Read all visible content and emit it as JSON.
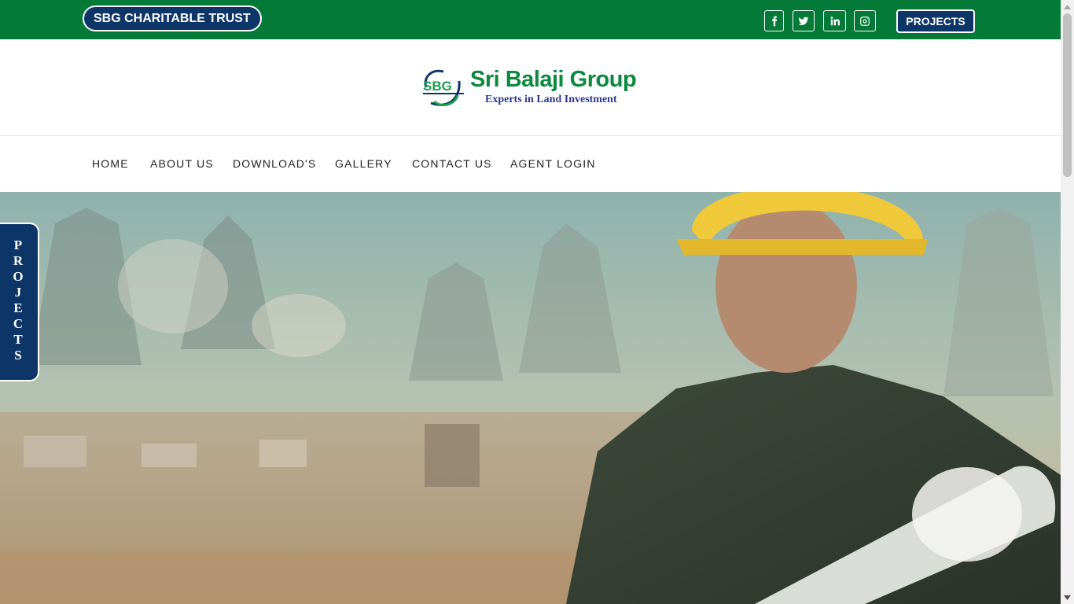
{
  "topbar": {
    "trust_label": "SBG CHARITABLE TRUST",
    "projects_label": "PROJECTS",
    "social": [
      "facebook-icon",
      "twitter-icon",
      "linkedin-icon",
      "instagram-icon"
    ],
    "bg_color": "#047a38",
    "button_color": "#0d3568"
  },
  "logo": {
    "mark": "SBG",
    "title": "Sri Balaji Group",
    "tagline": "Experts in Land Investment"
  },
  "nav": {
    "items": [
      "HOME",
      "ABOUT US",
      "DOWNLOAD'S",
      "GALLERY",
      "CONTACT US",
      "AGENT LOGIN"
    ]
  },
  "side_tab": {
    "letters": [
      "P",
      "R",
      "O",
      "J",
      "E",
      "C",
      "T",
      "S"
    ]
  },
  "hero": {
    "image": "construction-worker-temple-banner"
  }
}
